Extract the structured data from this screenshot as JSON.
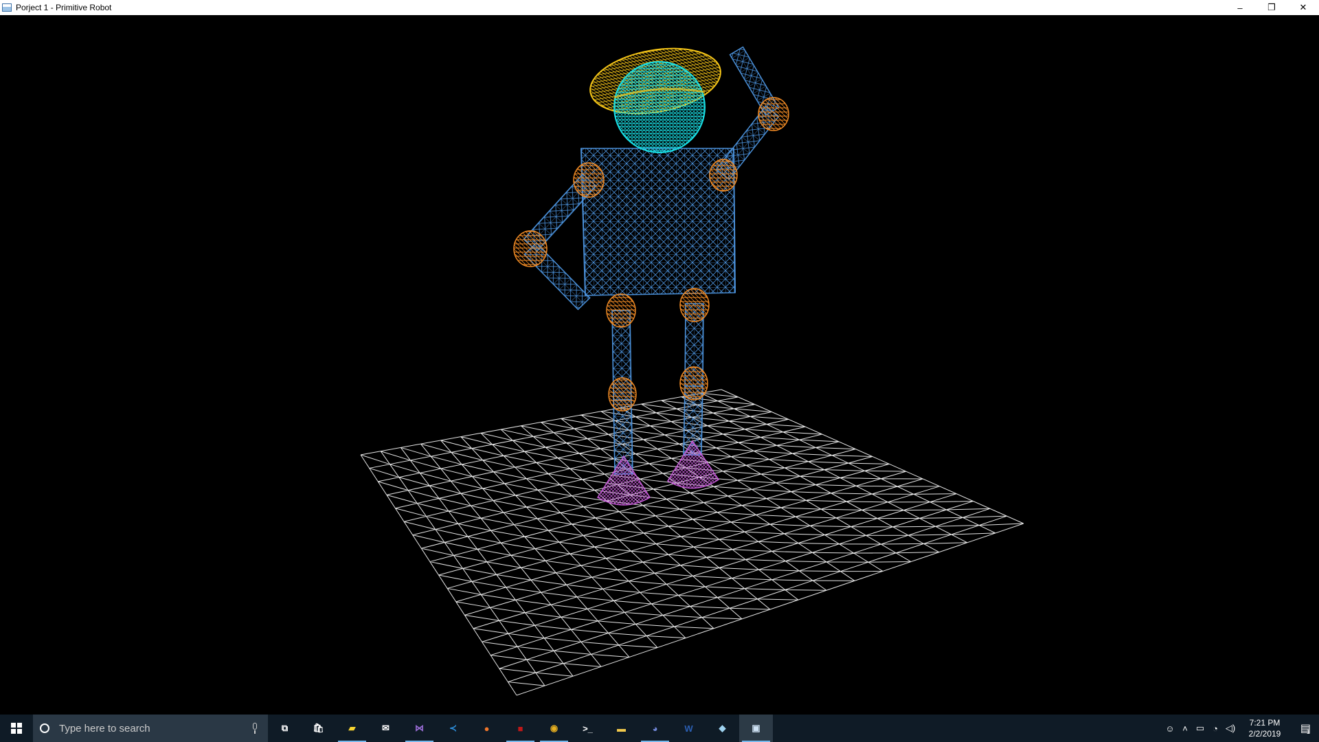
{
  "window": {
    "title": "Porject 1 - Primitive Robot",
    "controls": {
      "minimize": "–",
      "restore": "❐",
      "close": "✕"
    }
  },
  "scene": {
    "background": "#000000",
    "colors": {
      "grid": "#ffffff",
      "body": "#4a90d9",
      "joint": "#f08a24",
      "head": "#19e0e6",
      "hat": "#f5c518",
      "foot": "#c45ad6"
    }
  },
  "taskbar": {
    "search_placeholder": "Type here to search",
    "apps": [
      {
        "name": "task-view-icon",
        "glyph": "⧉",
        "color": "#ffffff"
      },
      {
        "name": "store-icon",
        "glyph": "🛍",
        "color": "#ffffff"
      },
      {
        "name": "sticky-notes-icon",
        "glyph": "▰",
        "color": "#f8d530"
      },
      {
        "name": "mail-icon",
        "glyph": "✉",
        "color": "#ffffff"
      },
      {
        "name": "visual-studio-icon",
        "glyph": "⋈",
        "color": "#9b6ed8"
      },
      {
        "name": "vscode-icon",
        "glyph": "≺",
        "color": "#2e8fdc"
      },
      {
        "name": "firefox-icon",
        "glyph": "●",
        "color": "#f0762a"
      },
      {
        "name": "red-app-icon",
        "glyph": "■",
        "color": "#c01818"
      },
      {
        "name": "chrome-icon",
        "glyph": "◉",
        "color": "#e8b020"
      },
      {
        "name": "terminal-icon",
        "glyph": ">_",
        "color": "#ffffff"
      },
      {
        "name": "file-explorer-icon",
        "glyph": "▬",
        "color": "#f2c94c"
      },
      {
        "name": "discord-icon",
        "glyph": "◕",
        "color": "#7289da"
      },
      {
        "name": "word-icon",
        "glyph": "W",
        "color": "#2b5fb3"
      },
      {
        "name": "paint-icon",
        "glyph": "◆",
        "color": "#9fd3f0"
      },
      {
        "name": "robot-app-icon",
        "glyph": "▣",
        "color": "#cfe3f5"
      }
    ],
    "clock": {
      "time": "7:21 PM",
      "date": "2/2/2019"
    },
    "notification_count": "1"
  }
}
